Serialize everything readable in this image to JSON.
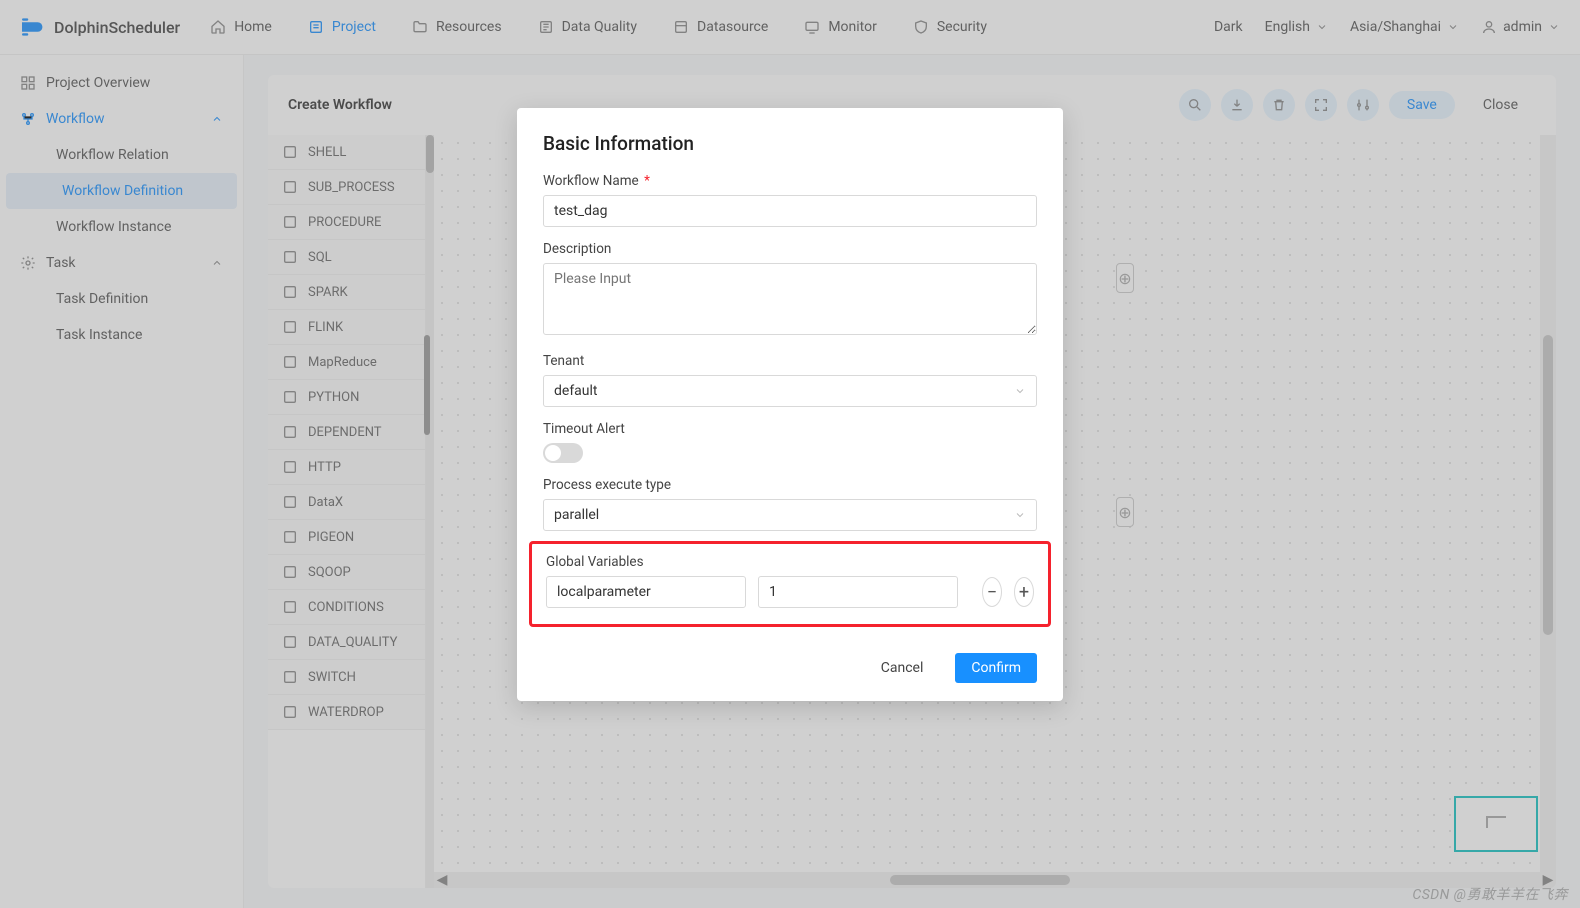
{
  "app": {
    "name": "DolphinScheduler"
  },
  "nav": {
    "items": [
      {
        "label": "Home"
      },
      {
        "label": "Project"
      },
      {
        "label": "Resources"
      },
      {
        "label": "Data Quality"
      },
      {
        "label": "Datasource"
      },
      {
        "label": "Monitor"
      },
      {
        "label": "Security"
      }
    ],
    "right": {
      "theme": "Dark",
      "lang": "English",
      "tz": "Asia/Shanghai",
      "user": "admin"
    }
  },
  "sidebar": {
    "overview": "Project Overview",
    "workflow": {
      "header": "Workflow",
      "relation": "Workflow Relation",
      "definition": "Workflow Definition",
      "instance": "Workflow Instance"
    },
    "task": {
      "header": "Task",
      "definition": "Task Definition",
      "instance": "Task Instance"
    }
  },
  "workarea": {
    "title": "Create Workflow",
    "save": "Save",
    "close": "Close",
    "tasks": [
      "SHELL",
      "SUB_PROCESS",
      "PROCEDURE",
      "SQL",
      "SPARK",
      "FLINK",
      "MapReduce",
      "PYTHON",
      "DEPENDENT",
      "HTTP",
      "DataX",
      "PIGEON",
      "SQOOP",
      "CONDITIONS",
      "DATA_QUALITY",
      "SWITCH",
      "WATERDROP"
    ]
  },
  "modal": {
    "title": "Basic Information",
    "workflow_name_label": "Workflow Name",
    "workflow_name_value": "test_dag",
    "description_label": "Description",
    "description_placeholder": "Please Input",
    "tenant_label": "Tenant",
    "tenant_value": "default",
    "timeout_label": "Timeout Alert",
    "exec_type_label": "Process execute type",
    "exec_type_value": "parallel",
    "gv_label": "Global Variables",
    "gv_key": "localparameter",
    "gv_value": "1",
    "cancel": "Cancel",
    "confirm": "Confirm"
  },
  "watermark": "CSDN @勇敢羊羊在飞奔"
}
